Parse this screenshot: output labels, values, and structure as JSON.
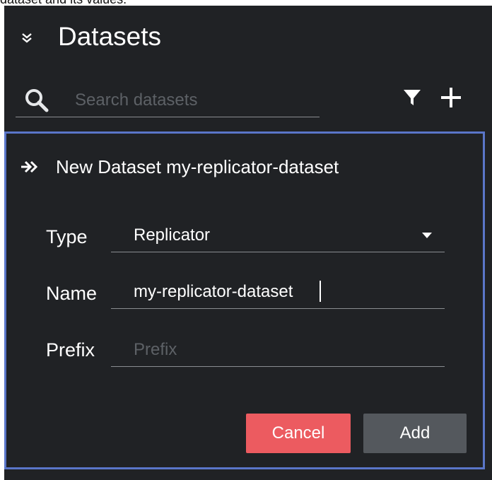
{
  "caption": "dataset and its values.",
  "header": {
    "title": "Datasets",
    "collapse_icon": "chevron-double-down-icon"
  },
  "search": {
    "placeholder": "Search datasets",
    "value": "",
    "icon": "search-icon"
  },
  "toolbar": {
    "filter_icon": "filter-icon",
    "add_icon": "plus-icon"
  },
  "form": {
    "title": "New Dataset my-replicator-dataset",
    "icon": "double-arrow-right-icon",
    "border_color": "#5a76c9",
    "type": {
      "label": "Type",
      "value": "Replicator"
    },
    "name": {
      "label": "Name",
      "value": "my-replicator-dataset"
    },
    "prefix": {
      "label": "Prefix",
      "placeholder": "Prefix",
      "value": ""
    },
    "cancel_label": "Cancel",
    "add_label": "Add"
  },
  "colors": {
    "background": "#202225",
    "cancel": "#ec5b60",
    "add": "#54585d"
  }
}
